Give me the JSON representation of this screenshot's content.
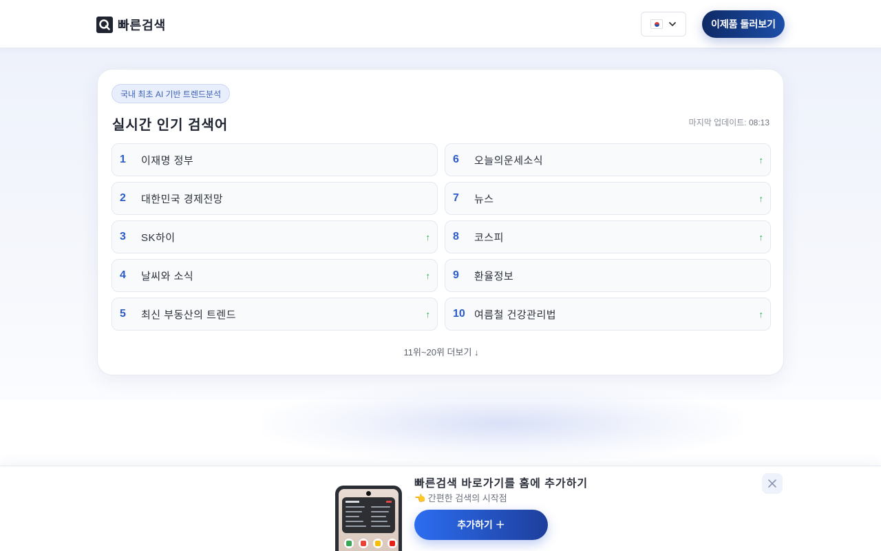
{
  "header": {
    "logo_text": "빠른검색",
    "language": "KR",
    "cta_label": "이제품 둘러보기"
  },
  "card": {
    "badge": "국내 최초 AI 기반 트렌드분석",
    "title": "실시간 인기 검색어",
    "update_label": "마지막 업데이트:",
    "update_time": "08:13",
    "items": [
      {
        "rank": "1",
        "keyword": "이재명 정부",
        "trend": ""
      },
      {
        "rank": "2",
        "keyword": "대한민국 경제전망",
        "trend": ""
      },
      {
        "rank": "3",
        "keyword": "SK하이",
        "trend": "↑"
      },
      {
        "rank": "4",
        "keyword": "날씨와 소식",
        "trend": "↑"
      },
      {
        "rank": "5",
        "keyword": "최신 부동산의 트렌드",
        "trend": "↑"
      },
      {
        "rank": "6",
        "keyword": "오늘의운세소식",
        "trend": "↑"
      },
      {
        "rank": "7",
        "keyword": "뉴스",
        "trend": "↑"
      },
      {
        "rank": "8",
        "keyword": "코스피",
        "trend": "↑"
      },
      {
        "rank": "9",
        "keyword": "환율정보",
        "trend": ""
      },
      {
        "rank": "10",
        "keyword": "여름철 건강관리법",
        "trend": "↑"
      }
    ],
    "more_label": "11위~20위 더보기 ↓"
  },
  "banner": {
    "title": "빠른검색 바로가기를 홈에 추가하기",
    "subtitle": "👈 간편한 검색의 시작점",
    "button_label": "추가하기 ＋"
  },
  "colors": {
    "accent": "#2b5bc6",
    "cta_dark": "#0f2a66",
    "trend_up": "#2ea34a"
  }
}
